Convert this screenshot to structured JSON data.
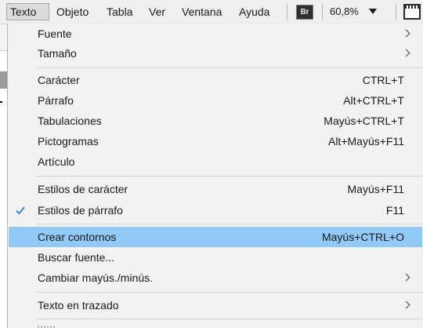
{
  "menubar": {
    "items": [
      {
        "label": "Texto",
        "active": true
      },
      {
        "label": "Objeto"
      },
      {
        "label": "Tabla"
      },
      {
        "label": "Ver"
      },
      {
        "label": "Ventana"
      },
      {
        "label": "Ayuda"
      }
    ],
    "bridge_badge": "Br",
    "zoom": "60,8%",
    "zoom_caret_icon": "triangle-down-icon",
    "arrange_icon": "arrange-documents-icon"
  },
  "menu": {
    "items": [
      {
        "label": "Fuente",
        "submenu": true
      },
      {
        "label": "Tamaño",
        "submenu": true
      },
      {
        "label": "Carácter",
        "shortcut": "CTRL+T"
      },
      {
        "label": "Párrafo",
        "shortcut": "Alt+CTRL+T"
      },
      {
        "label": "Tabulaciones",
        "shortcut": "Mayús+CTRL+T"
      },
      {
        "label": "Pictogramas",
        "shortcut": "Alt+Mayús+F11"
      },
      {
        "label": "Artículo"
      },
      {
        "label": "Estilos de carácter",
        "shortcut": "Mayús+F11"
      },
      {
        "label": "Estilos de párrafo",
        "shortcut": "F11",
        "checked": true
      },
      {
        "label": "Crear contornos",
        "shortcut": "Mayús+CTRL+O",
        "highlighted": true
      },
      {
        "label": "Buscar fuente..."
      },
      {
        "label": "Cambiar mayús./minús.",
        "submenu": true
      },
      {
        "label": "Texto en trazado",
        "submenu": true
      }
    ],
    "highlight_color": "#91c9f7",
    "background_color": "#f2f2f2"
  }
}
